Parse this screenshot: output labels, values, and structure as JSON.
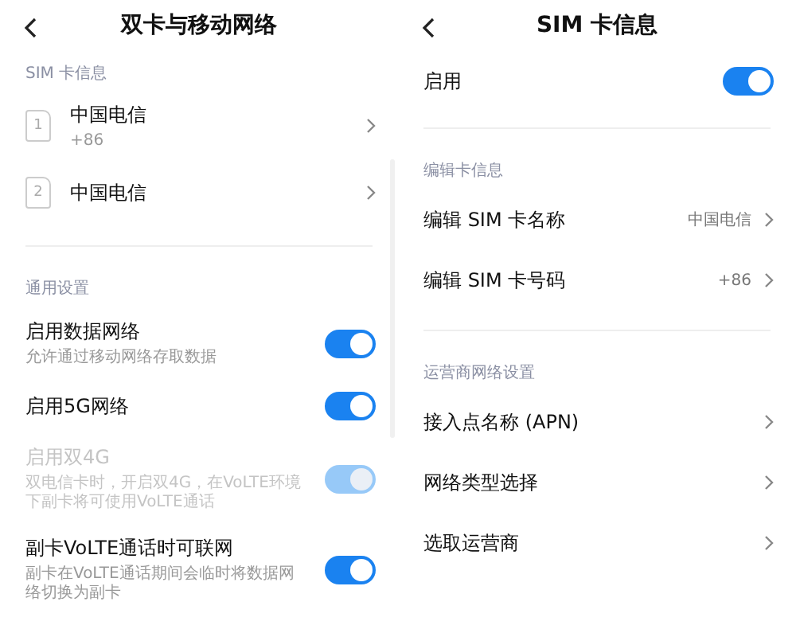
{
  "screens": [
    {
      "title": "双卡与移动网络",
      "sections": [
        {
          "header": "SIM 卡信息",
          "items": [
            {
              "kind": "sim",
              "slot": "1",
              "title": "中国电信",
              "subtitle": "+86"
            },
            {
              "kind": "sim",
              "slot": "2",
              "title": "中国电信"
            }
          ]
        },
        {
          "header": "通用设置",
          "items": [
            {
              "kind": "toggle",
              "title": "启用数据网络",
              "subtitle": "允许通过移动网络存取数据",
              "on": true,
              "disabled": false
            },
            {
              "kind": "toggle",
              "title": "启用5G网络",
              "on": true,
              "disabled": false
            },
            {
              "kind": "toggle",
              "title": "启用双4G",
              "subtitle": "双电信卡时，开启双4G，在VoLTE环境下副卡将可使用VoLTE通话",
              "on": true,
              "disabled": true
            },
            {
              "kind": "toggle",
              "title": "副卡VoLTE通话时可联网",
              "subtitle": "副卡在VoLTE通话期间会临时将数据网络切换为副卡",
              "on": true,
              "disabled": false
            }
          ]
        }
      ]
    },
    {
      "title": "SIM 卡信息",
      "sections": [
        {
          "items": [
            {
              "kind": "toggle",
              "title": "启用",
              "on": true,
              "disabled": false
            }
          ]
        },
        {
          "header": "编辑卡信息",
          "items": [
            {
              "kind": "nav",
              "title": "编辑 SIM 卡名称",
              "value": "中国电信"
            },
            {
              "kind": "nav",
              "title": "编辑 SIM 卡号码",
              "value": "+86"
            }
          ]
        },
        {
          "header": "运营商网络设置",
          "items": [
            {
              "kind": "nav",
              "title": "接入点名称 (APN)"
            },
            {
              "kind": "nav",
              "title": "网络类型选择"
            },
            {
              "kind": "nav",
              "title": "选取运营商"
            }
          ]
        }
      ]
    }
  ]
}
